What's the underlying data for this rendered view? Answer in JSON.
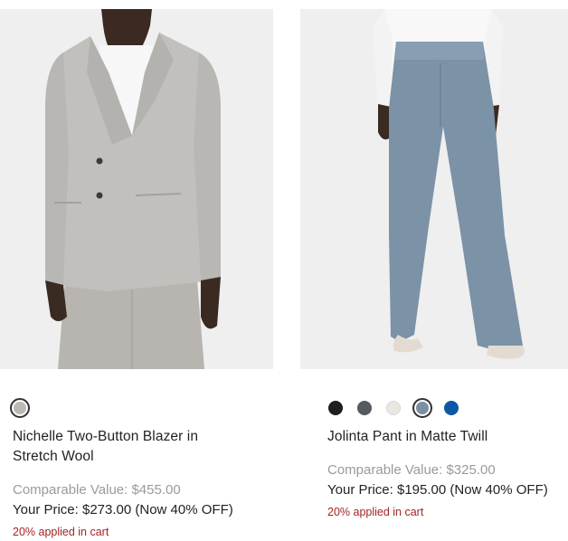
{
  "products": [
    {
      "name": "Nichelle Two-Button Blazer in Stretch Wool",
      "comparable_label": "Comparable Value: $455.00",
      "price_label": "Your Price: $273.00 (Now 40% OFF)",
      "promo_label": "20% applied in cart",
      "swatches": [
        {
          "color": "#bdb9b3",
          "selected": true
        }
      ]
    },
    {
      "name": "Jolinta Pant in Matte Twill",
      "comparable_label": "Comparable Value: $325.00",
      "price_label": "Your Price: $195.00 (Now 40% OFF)",
      "promo_label": "20% applied in cart",
      "swatches": [
        {
          "color": "#1e1e1e",
          "selected": false
        },
        {
          "color": "#555960",
          "selected": false
        },
        {
          "color": "#ebe6df",
          "selected": false
        },
        {
          "color": "#7b8fa4",
          "selected": true
        },
        {
          "color": "#0d57a5",
          "selected": false
        }
      ]
    }
  ],
  "colors": {
    "promo": "#a42323",
    "comparable": "#9a9a9a",
    "image_bg": "#efefef"
  }
}
